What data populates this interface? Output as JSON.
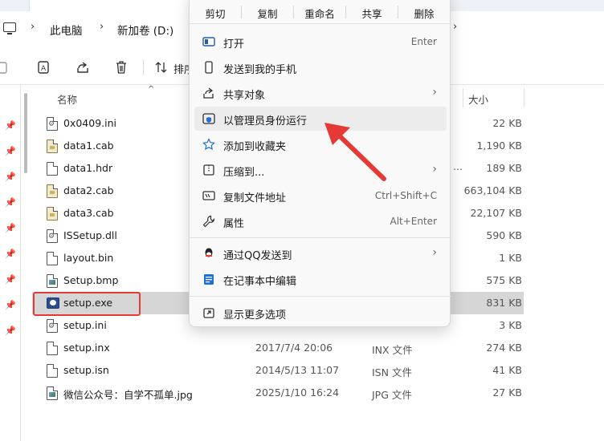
{
  "breadcrumb": {
    "items": [
      "此电脑",
      "新加卷 (D:)"
    ]
  },
  "commandbar": {
    "sort_label": "排序"
  },
  "columns": {
    "name": "名称",
    "size": "大小"
  },
  "files": [
    {
      "name": "0x0409.ini",
      "date": "",
      "type": "",
      "size": "22 KB",
      "icon": "settings-file-icon"
    },
    {
      "name": "data1.cab",
      "date": "",
      "type": "",
      "size": "1,190 KB",
      "icon": "cab-file-icon"
    },
    {
      "name": "data1.hdr",
      "date": "",
      "type": "",
      "size": "189 KB",
      "icon": "file-icon"
    },
    {
      "name": "data2.cab",
      "date": "",
      "type": "",
      "size": "663,104 KB",
      "icon": "cab-file-icon"
    },
    {
      "name": "data3.cab",
      "date": "",
      "type": "",
      "size": "22,107 KB",
      "icon": "cab-file-icon"
    },
    {
      "name": "ISSetup.dll",
      "date": "",
      "type": "",
      "size": "590 KB",
      "icon": "dll-file-icon"
    },
    {
      "name": "layout.bin",
      "date": "",
      "type": "",
      "size": "1 KB",
      "icon": "file-icon"
    },
    {
      "name": "Setup.bmp",
      "date": "",
      "type": "",
      "size": "575 KB",
      "icon": "image-file-icon"
    },
    {
      "name": "setup.exe",
      "date": "",
      "type": "",
      "size": "831 KB",
      "icon": "exe-file-icon"
    },
    {
      "name": "setup.ini",
      "date": "",
      "type": "",
      "size": "3 KB",
      "icon": "settings-file-icon"
    },
    {
      "name": "setup.inx",
      "date": "2017/7/4 20:06",
      "type": "INX 文件",
      "size": "274 KB",
      "icon": "file-icon"
    },
    {
      "name": "setup.isn",
      "date": "2014/5/13 11:07",
      "type": "ISN 文件",
      "size": "41 KB",
      "icon": "file-icon"
    },
    {
      "name": "微信公众号：自学不孤单.jpg",
      "date": "2025/1/10 16:24",
      "type": "JPG 文件",
      "size": "27 KB",
      "icon": "image-file-icon"
    }
  ],
  "context_menu": {
    "quick_actions": [
      "剪切",
      "复制",
      "重命名",
      "共享",
      "删除"
    ],
    "items": [
      {
        "label": "打开",
        "shortcut": "Enter",
        "icon": "open-icon"
      },
      {
        "label": "发送到我的手机",
        "shortcut": "",
        "icon": "phone-icon"
      },
      {
        "label": "共享对象",
        "shortcut": "",
        "icon": "share-icon",
        "submenu": true
      },
      {
        "label": "以管理员身份运行",
        "shortcut": "",
        "icon": "shield-icon",
        "hover": true
      },
      {
        "label": "添加到收藏夹",
        "shortcut": "",
        "icon": "star-icon"
      },
      {
        "label": "压缩到...",
        "shortcut": "",
        "icon": "zip-icon",
        "submenu": true
      },
      {
        "label": "复制文件地址",
        "shortcut": "Ctrl+Shift+C",
        "icon": "copy-path-icon"
      },
      {
        "label": "属性",
        "shortcut": "Alt+Enter",
        "icon": "wrench-icon"
      },
      {
        "label": "通过QQ发送到",
        "shortcut": "",
        "icon": "qq-icon",
        "submenu": true
      },
      {
        "label": "在记事本中编辑",
        "shortcut": "",
        "icon": "notepad-icon"
      },
      {
        "label": "显示更多选项",
        "shortcut": "",
        "icon": "more-options-icon"
      }
    ]
  },
  "colors": {
    "annotation_red": "#e53935",
    "selected_row": "#d6d6d6",
    "hover_item": "#ececec"
  }
}
